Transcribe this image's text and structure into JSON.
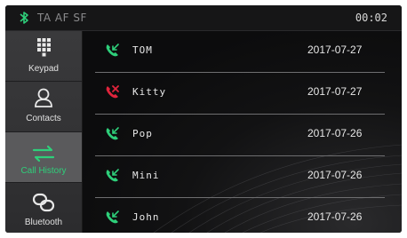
{
  "status": {
    "bluetooth_icon": "bluetooth-icon",
    "rds_flags": "TA AF SF",
    "time": "00:02"
  },
  "sidebar": {
    "items": [
      {
        "label": "Keypad",
        "icon": "keypad-icon",
        "active": false
      },
      {
        "label": "Contacts",
        "icon": "contacts-icon",
        "active": false
      },
      {
        "label": "Call History",
        "icon": "call-history-icon",
        "active": true
      },
      {
        "label": "Bluetooth",
        "icon": "bluetooth-link-icon",
        "active": false
      }
    ]
  },
  "call_history": [
    {
      "name": "TOM",
      "date": "2017-07-27",
      "type": "received"
    },
    {
      "name": "Kitty",
      "date": "2017-07-27",
      "type": "missed"
    },
    {
      "name": "Pop",
      "date": "2017-07-26",
      "type": "received"
    },
    {
      "name": "Mini",
      "date": "2017-07-26",
      "type": "received"
    },
    {
      "name": "John",
      "date": "2017-07-26",
      "type": "received"
    }
  ],
  "colors": {
    "accent_green": "#2ecf7a",
    "missed_red": "#e0243c",
    "background": "#0c0c0d"
  }
}
